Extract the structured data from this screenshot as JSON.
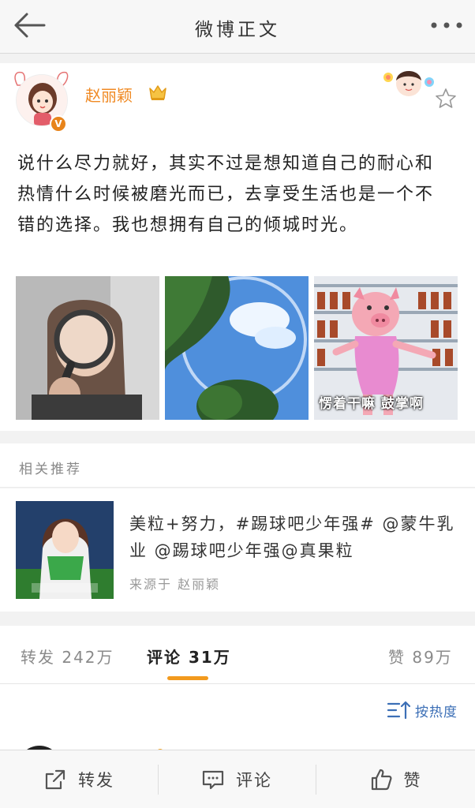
{
  "header": {
    "title": "微博正文"
  },
  "post": {
    "author": "赵丽颖",
    "text": "说什么尽力就好，其实不过是想知道自己的耐心和热情什么时候被磨光而已，去享受生活也是一个不错的选择。我也想拥有自己的倾城时光。",
    "image3_caption": "愣着干嘛 鼓掌啊"
  },
  "related": {
    "header": "相关推荐",
    "text": "美粒+努力，#踢球吧少年强# @蒙牛乳业 @踢球吧少年强@真果粒",
    "source": "来源于 赵丽颖"
  },
  "tabs": {
    "repost": "转发 242万",
    "comment": "评论 31万",
    "like": "赞 89万"
  },
  "sort": {
    "label": "按热度"
  },
  "bottom": {
    "repost": "转发",
    "comment": "评论",
    "like": "赞"
  },
  "colors": {
    "accent": "#f29a1e",
    "author": "#f08a24",
    "link": "#3c6fb6"
  }
}
